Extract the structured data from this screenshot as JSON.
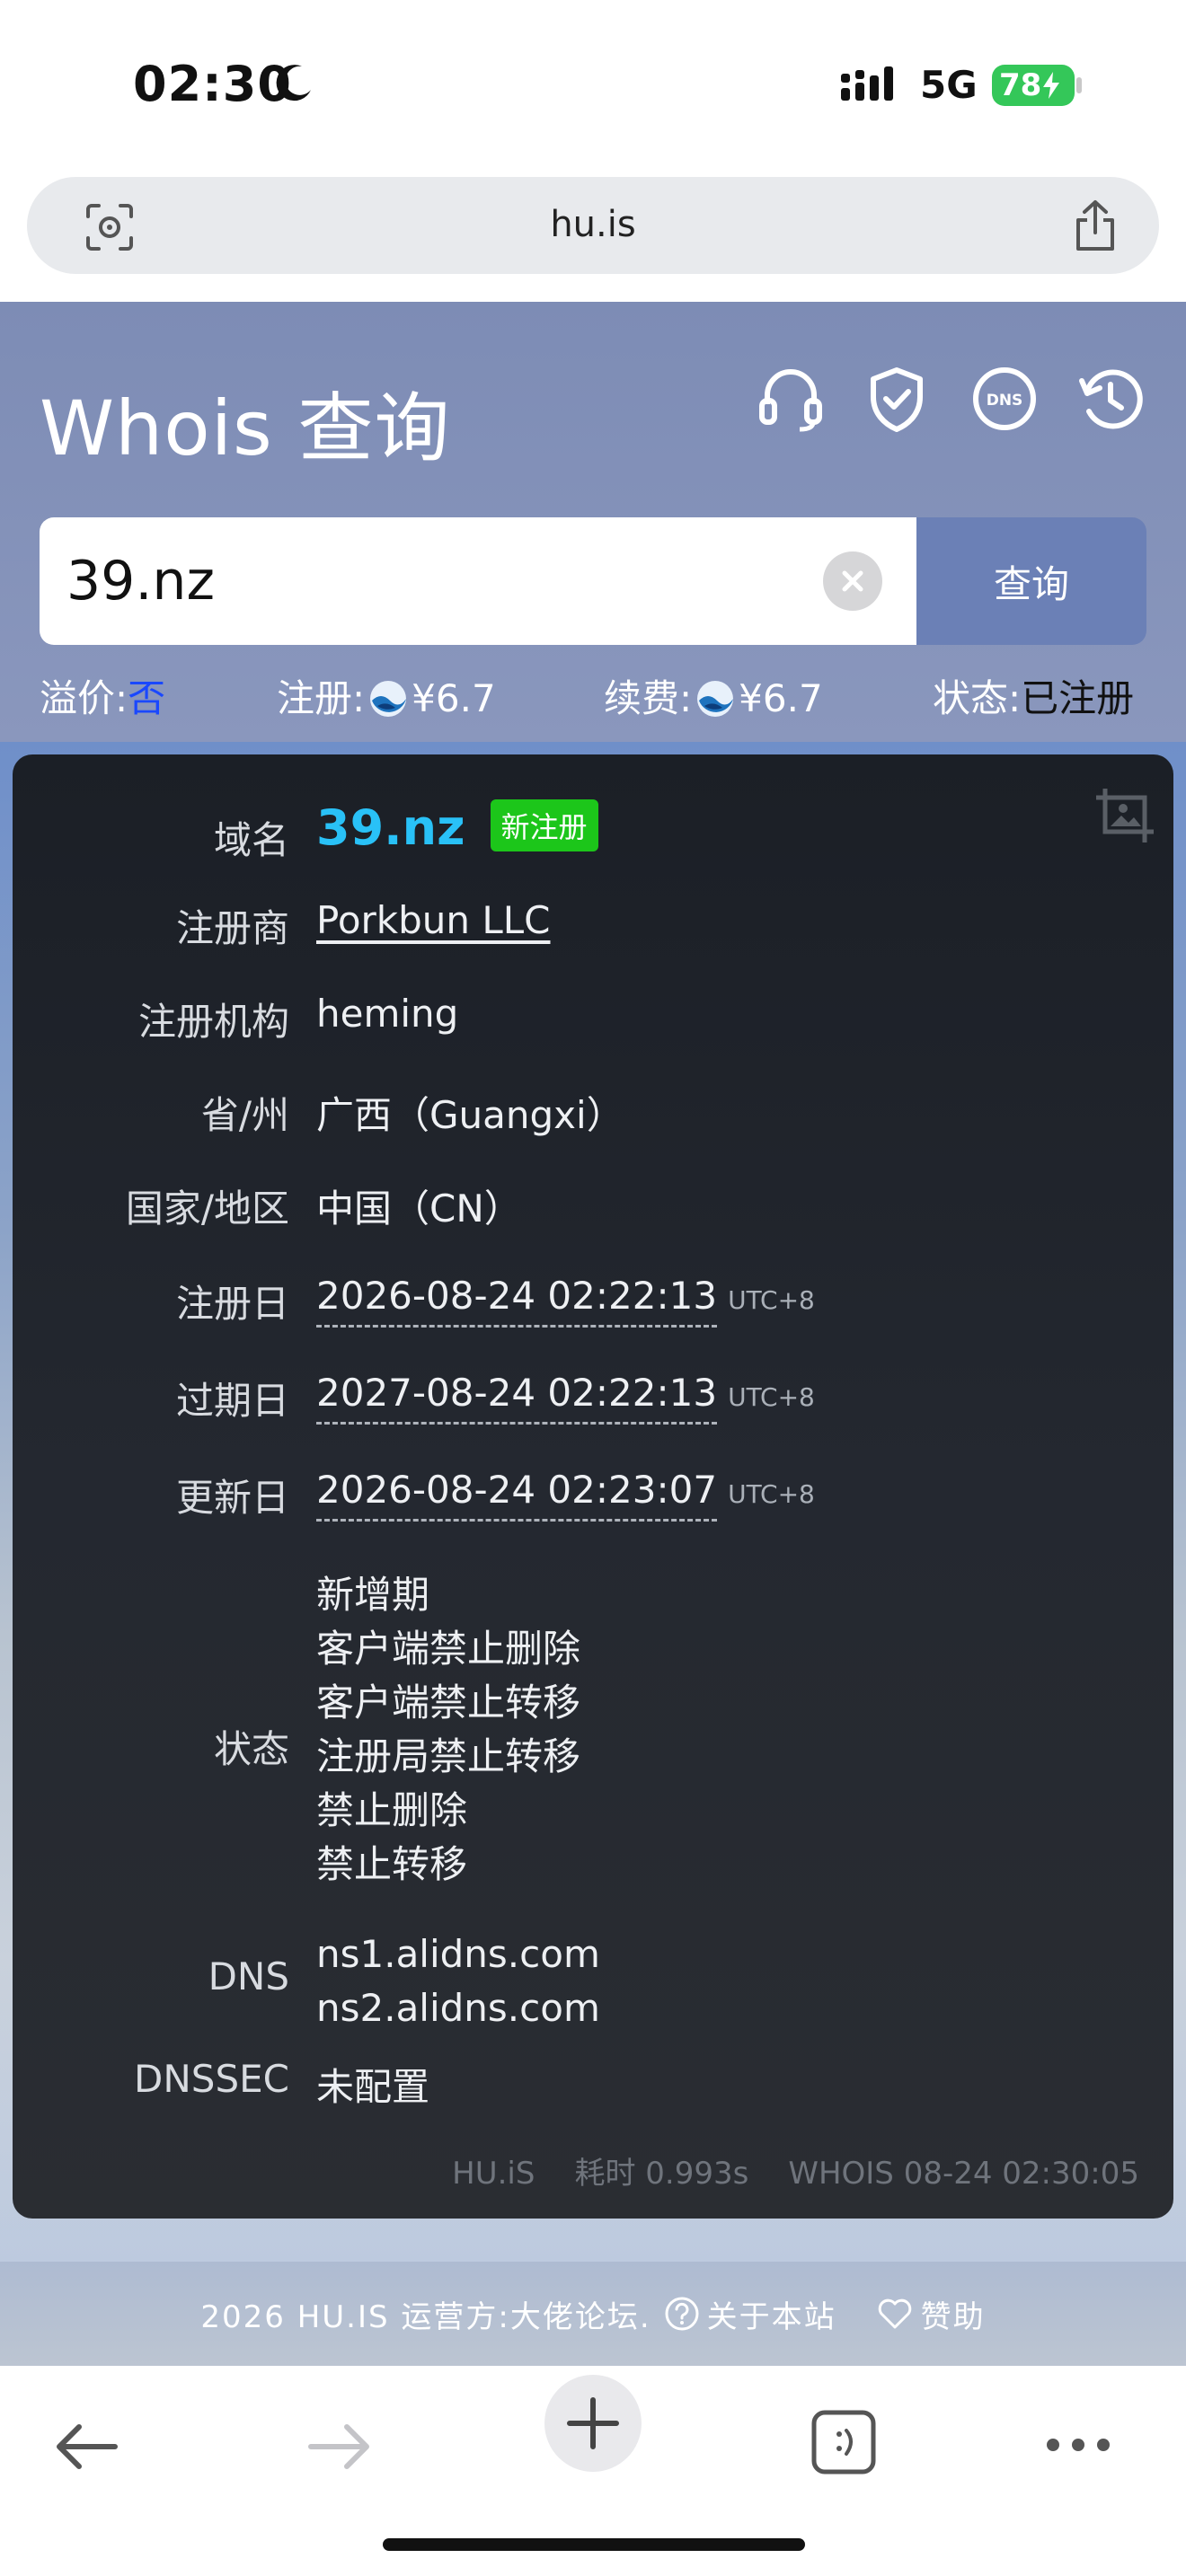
{
  "status_bar": {
    "time": "02:30",
    "network": "5G",
    "battery": "78"
  },
  "browser": {
    "url": "hu.is"
  },
  "header": {
    "title": "Whois 查询",
    "icons": [
      "headset-icon",
      "shield-check-icon",
      "dns-icon",
      "history-icon"
    ],
    "dns_icon_text": "DNS"
  },
  "search": {
    "value": "39.nz",
    "button_label": "查询"
  },
  "pricing": {
    "premium_label": "溢价:",
    "premium_value": "否",
    "register_label": "注册:",
    "register_price": "¥6.7",
    "renew_label": "续费:",
    "renew_price": "¥6.7",
    "status_label": "状态:",
    "status_value": "已注册"
  },
  "whois": {
    "domain_label": "域名",
    "domain": "39.nz",
    "domain_badge": "新注册",
    "registrar_label": "注册商",
    "registrar": "Porkbun LLC",
    "org_label": "注册机构",
    "org": "heming",
    "province_label": "省/州",
    "province": "广西（Guangxi）",
    "country_label": "国家/地区",
    "country": "中国（CN）",
    "created_label": "注册日",
    "created": "2026-08-24 02:22:13",
    "created_tz": "UTC+8",
    "expires_label": "过期日",
    "expires": "2027-08-24 02:22:13",
    "expires_tz": "UTC+8",
    "updated_label": "更新日",
    "updated": "2026-08-24 02:23:07",
    "updated_tz": "UTC+8",
    "status_label": "状态",
    "statuses": [
      "新增期",
      "客户端禁止删除",
      "客户端禁止转移",
      "注册局禁止转移",
      "禁止删除",
      "禁止转移"
    ],
    "dns_label": "DNS",
    "dns": [
      "ns1.alidns.com",
      "ns2.alidns.com"
    ],
    "dnssec_label": "DNSSEC",
    "dnssec": "未配置"
  },
  "card_footer": {
    "brand": "HU.iS",
    "elapsed": "耗时 0.993s",
    "whois_time": "WHOIS 08-24 02:30:05"
  },
  "site_footer": {
    "copyright": "2026 HU.IS 运营方:大佬论坛.",
    "about": "关于本站",
    "sponsor": "赞助"
  },
  "colors": {
    "header_bg": "#7d8cb5",
    "search_button": "#6b80b6",
    "domain_accent": "#29c1f7",
    "badge_green": "#1cc61a",
    "premium_blue": "#1a48ff",
    "battery_green": "#34c759"
  }
}
